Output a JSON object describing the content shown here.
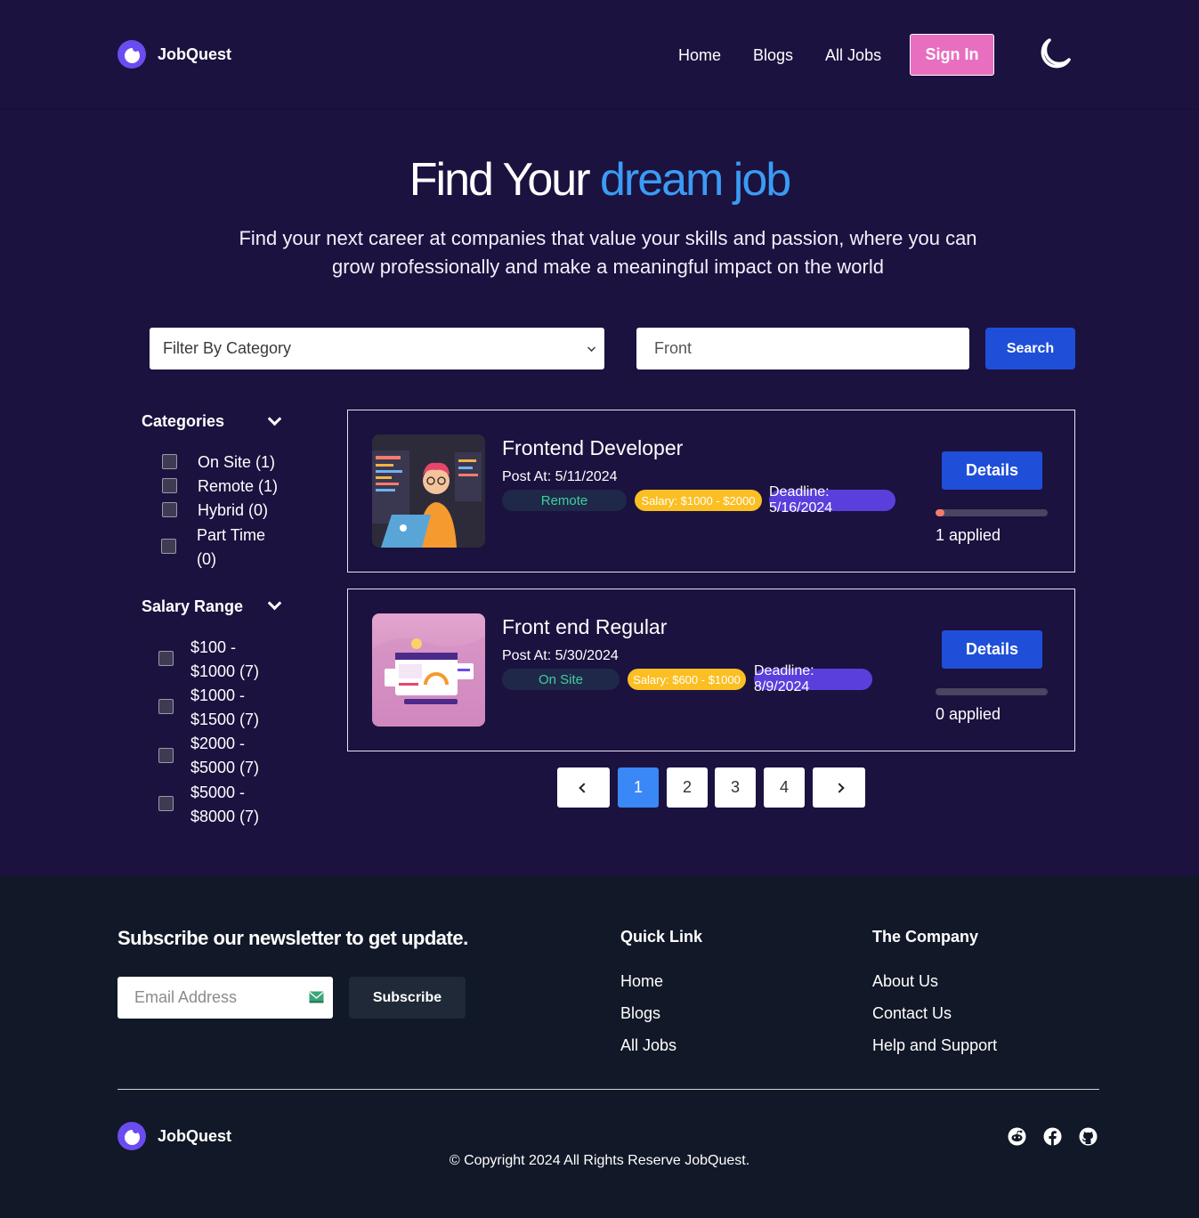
{
  "nav": {
    "brand": "JobQuest",
    "links": [
      "Home",
      "Blogs",
      "All Jobs"
    ],
    "sign_in": "Sign In",
    "theme_icon": "moon-icon"
  },
  "hero": {
    "title_plain": "Find Your",
    "title_accent": "dream job",
    "subtitle": "Find your next career at companies that value your skills and passion, where you can grow professionally and make a meaningful impact on the world"
  },
  "search": {
    "category_placeholder": "Filter By Category",
    "query_value": "Front",
    "button": "Search"
  },
  "sidebar": {
    "categories_title": "Categories",
    "categories": [
      {
        "label": "On Site (1)"
      },
      {
        "label": "Remote (1)"
      },
      {
        "label": "Hybrid (0)"
      },
      {
        "label_line1": "Part Time",
        "label_line2": "(0)"
      }
    ],
    "salary_title": "Salary Range",
    "salary_ranges": [
      {
        "line1": "$100 -",
        "line2": "$1000 (7)"
      },
      {
        "line1": "$1000 -",
        "line2": "$1500 (7)"
      },
      {
        "line1": "$2000 -",
        "line2": "$5000 (7)"
      },
      {
        "line1": "$5000 -",
        "line2": "$8000 (7)"
      }
    ]
  },
  "jobs": [
    {
      "title": "Frontend Developer",
      "posted": "Post At: 5/11/2024",
      "type": "Remote",
      "salary": "Salary: $1000 - $2000",
      "deadline": "Deadline: 5/16/2024",
      "details": "Details",
      "applied": "1 applied",
      "progress": 0.08
    },
    {
      "title": "Front end Regular",
      "posted": "Post At: 5/30/2024",
      "type": "On Site",
      "salary": "Salary: $600 - $1000",
      "deadline": "Deadline: 8/9/2024",
      "details": "Details",
      "applied": "0 applied",
      "progress": 0
    }
  ],
  "pagination": {
    "pages": [
      "1",
      "2",
      "3",
      "4"
    ],
    "active": "1"
  },
  "footer": {
    "newsletter_title": "Subscribe our newsletter to get update.",
    "email_placeholder": "Email Address",
    "subscribe": "Subscribe",
    "quick_link_title": "Quick Link",
    "quick_links": [
      "Home",
      "Blogs",
      "All Jobs"
    ],
    "company_title": "The Company",
    "company_links": [
      "About Us",
      "Contact Us",
      "Help and Support"
    ],
    "brand": "JobQuest",
    "copyright": "© Copyright 2024 All Rights Reserve JobQuest.",
    "social_icons": [
      "reddit-icon",
      "facebook-icon",
      "github-icon"
    ]
  },
  "colors": {
    "background": "#1b123f",
    "accent_blue": "#3b9bf5",
    "button_blue": "#1f4fd8",
    "sign_in_pink": "#e86fc0",
    "salary_chip": "#fbbf24",
    "deadline_chip": "#5b3fdc",
    "footer_bg": "#111827"
  }
}
